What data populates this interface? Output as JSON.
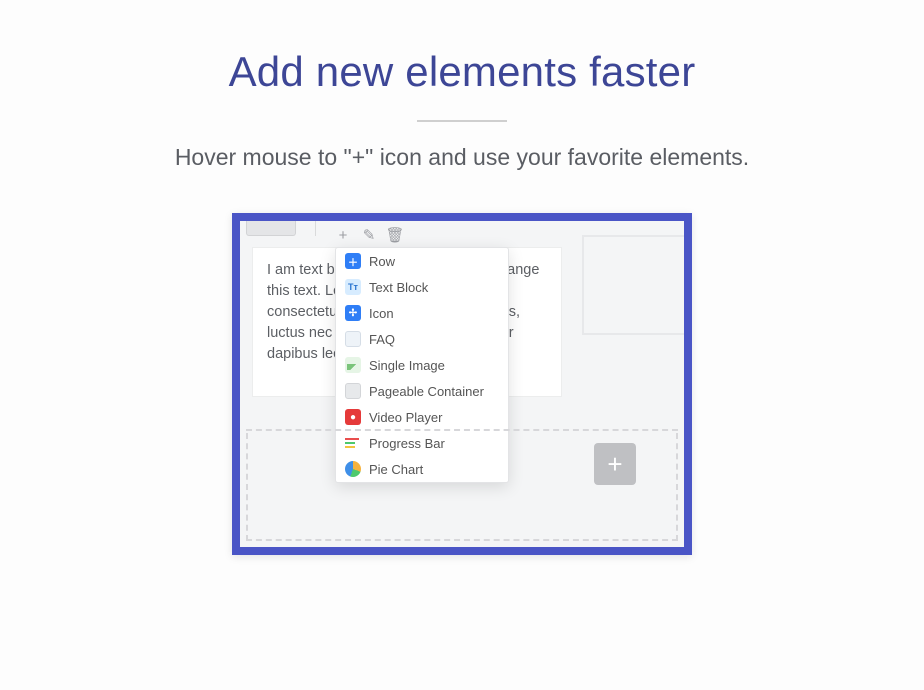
{
  "headline": "Add new elements faster",
  "subhead": "Hover mouse to \"+\" icon and use your favorite elements.",
  "text_block": "I am text block. Click edit button to change this text. Lorem ipsum dolor sit amet, consectetur adipiscing elit. Ut elit tellus, luctus nec ullamcorper mattis, pulvinar dapibus leo.",
  "toolbar": {
    "plus_glyph": "+",
    "pencil_glyph": "✎",
    "trash_glyph": "🗑"
  },
  "big_plus_glyph": "+",
  "dropdown": [
    {
      "label": "Row",
      "icon_class": "i-row",
      "glyph": "＋"
    },
    {
      "label": "Text Block",
      "icon_class": "i-text",
      "glyph": "Tᴛ"
    },
    {
      "label": "Icon",
      "icon_class": "i-icon",
      "glyph": "✢"
    },
    {
      "label": "FAQ",
      "icon_class": "i-faq",
      "glyph": ""
    },
    {
      "label": "Single Image",
      "icon_class": "i-img",
      "glyph": ""
    },
    {
      "label": "Pageable Container",
      "icon_class": "i-page",
      "glyph": ""
    },
    {
      "label": "Video Player",
      "icon_class": "i-video",
      "glyph": "●"
    },
    {
      "label": "Progress Bar",
      "icon_class": "i-prog",
      "glyph": ""
    },
    {
      "label": "Pie Chart",
      "icon_class": "i-pie",
      "glyph": ""
    }
  ]
}
